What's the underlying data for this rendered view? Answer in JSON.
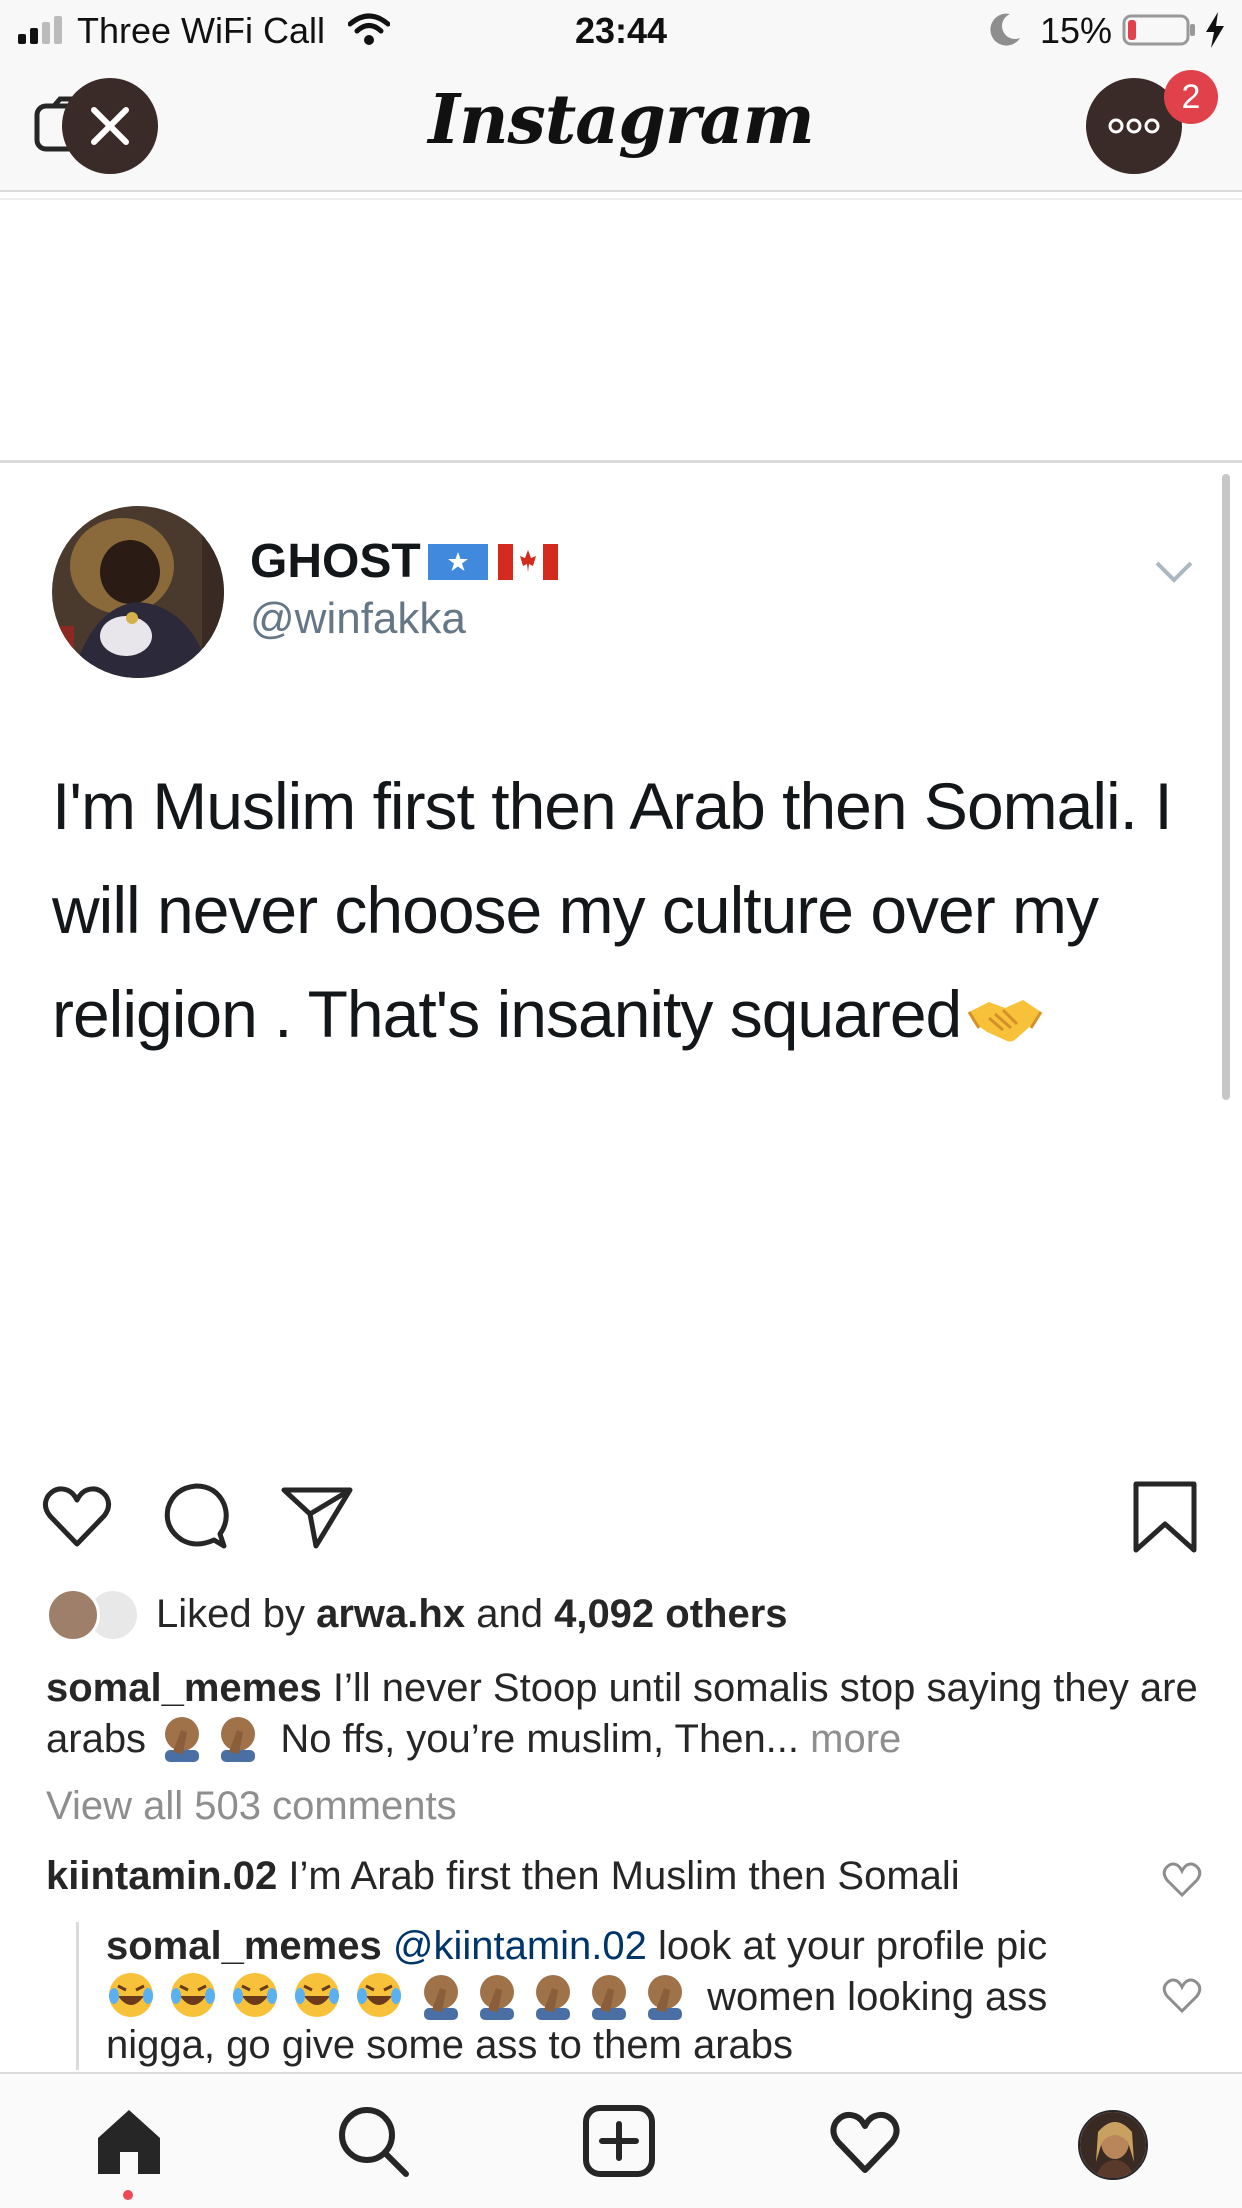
{
  "status_bar": {
    "carrier": "Three WiFi Call",
    "time": "23:44",
    "battery_percent": "15%",
    "battery_level": 0.15,
    "battery_color": "#e0414a"
  },
  "nav": {
    "title": "Instagram",
    "notification_count": "2"
  },
  "tweet": {
    "display_name": "GHOST",
    "flags": [
      "Somalia flag",
      "Canada flag"
    ],
    "handle": "@winfakka",
    "text": "I'm Muslim first then Arab then Somali. I will never choose my culture over my religion . That's insanity squared"
  },
  "post": {
    "liked_by_prefix": "Liked by",
    "liked_by_user": "arwa.hx",
    "liked_by_and": "and",
    "liked_by_others": "4,092 others",
    "caption_user": "somal_memes",
    "caption_text_1": "I’ll never Stoop until somalis stop saying they are arabs",
    "caption_text_2": "No ffs, you’re muslim, Then...",
    "caption_more": "more",
    "view_all": "View all 503 comments",
    "comments": [
      {
        "user": "kiintamin.02",
        "text": "I’m Arab first then Muslim then Somali"
      }
    ],
    "reply": {
      "user": "somal_memes",
      "mention": "@kiintamin.02",
      "text_1": "look at your profile pic",
      "text_2": "women looking ass nigga, go give some ass to them arabs"
    }
  },
  "icons": {
    "nav": [
      "camera-icon",
      "close-icon",
      "more-icon"
    ],
    "actions": [
      "heart-icon",
      "comment-icon",
      "share-icon",
      "bookmark-icon"
    ],
    "tabs": [
      "home-icon",
      "search-icon",
      "add-post-icon",
      "activity-heart-icon",
      "profile-avatar"
    ]
  }
}
